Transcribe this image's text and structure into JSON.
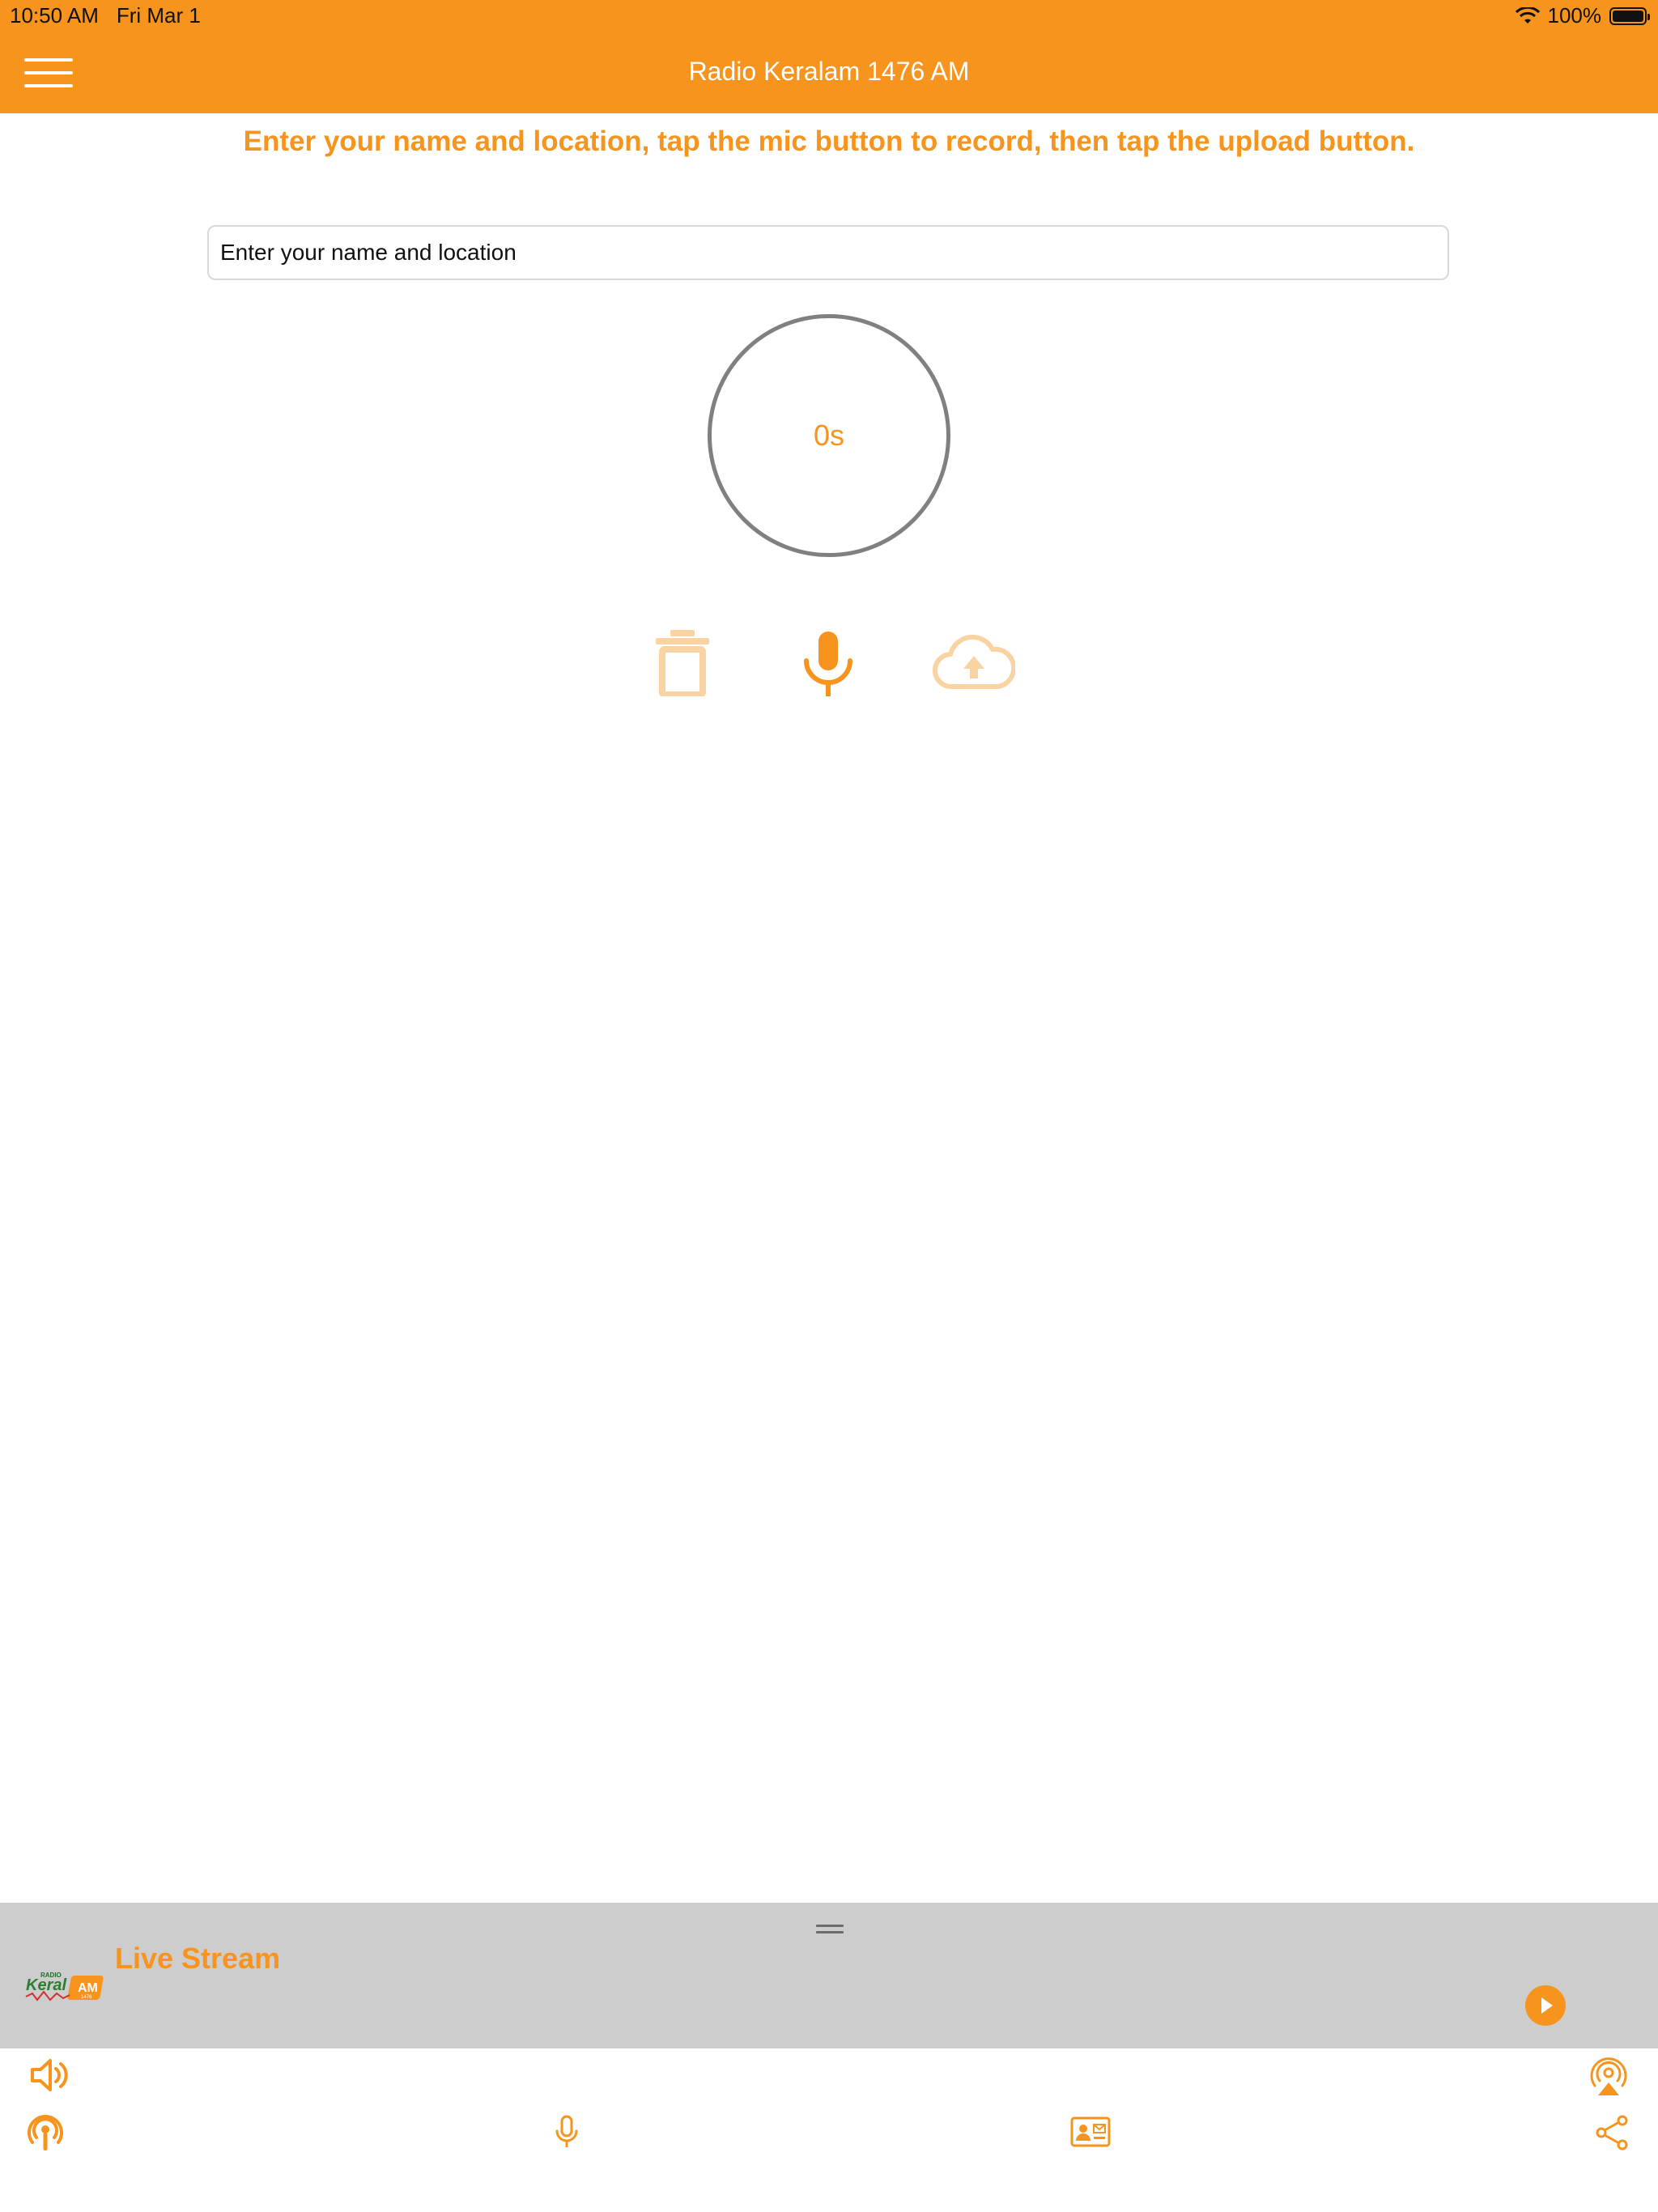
{
  "status_bar": {
    "time": "10:50 AM",
    "date": "Fri Mar 1",
    "battery": "100%"
  },
  "nav": {
    "title": "Radio Keralam 1476 AM",
    "menu_icon": "hamburger-menu-icon"
  },
  "recorder": {
    "instructions": "Enter your name and location, tap the mic button to record, then tap the upload button.",
    "name_placeholder": "Enter your name and location",
    "name_value": "",
    "timer": "0s",
    "actions": [
      {
        "name": "delete",
        "icon": "trash-icon",
        "enabled": false
      },
      {
        "name": "record",
        "icon": "microphone-icon",
        "enabled": true
      },
      {
        "name": "upload",
        "icon": "cloud-upload-icon",
        "enabled": false
      }
    ]
  },
  "player": {
    "label": "Live Stream",
    "logo_text": "RADIO Keralam AM 1476",
    "play_icon": "play-icon"
  },
  "tab_bar": {
    "left_top_icon": "speaker-icon",
    "left_bottom_icon": "podcast-icon",
    "mic_icon": "microphone-icon",
    "contact_icon": "contact-card-icon",
    "right_top_icon": "airplay-icon",
    "right_bottom_icon": "share-icon"
  },
  "colors": {
    "accent": "#F7941E",
    "accent_disabled": "#FAD3A2",
    "circle_border": "#808080",
    "player_bg": "#CDCDCD"
  }
}
